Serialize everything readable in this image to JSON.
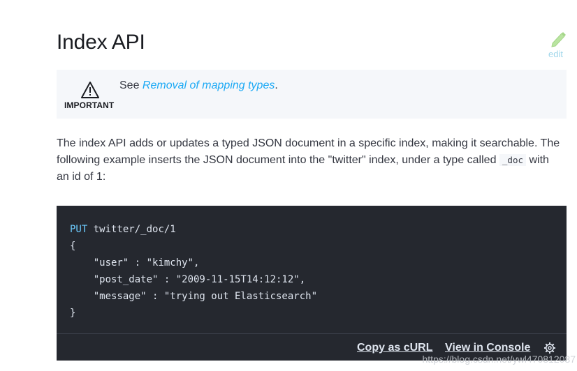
{
  "page": {
    "title": "Index API",
    "edit_label": "edit"
  },
  "admonition": {
    "label": "IMPORTANT",
    "text_prefix": "See ",
    "link_text": "Removal of mapping types",
    "text_suffix": ".",
    "icon": "warning-icon"
  },
  "intro": {
    "part1": "The index API adds or updates a typed JSON document in a specific index, making it searchable. The following example inserts the JSON document into the \"twitter\" index, under a type called ",
    "code": "_doc",
    "part2": " with an id of 1:"
  },
  "code_block": {
    "method": "PUT",
    "path": " twitter/_doc/1",
    "body": "{\n    \"user\" : \"kimchy\",\n    \"post_date\" : \"2009-11-15T14:12:12\",\n    \"message\" : \"trying out Elasticsearch\"\n}",
    "copy_curl": "Copy as cURL",
    "view_console": "View in Console",
    "settings_icon": "gear-icon"
  },
  "watermark": "https://blog.csdn.net/ywl470812087",
  "colors": {
    "link": "#1ba9f5",
    "code_bg": "#25282f",
    "admonition_bg": "#f5f7fa"
  }
}
